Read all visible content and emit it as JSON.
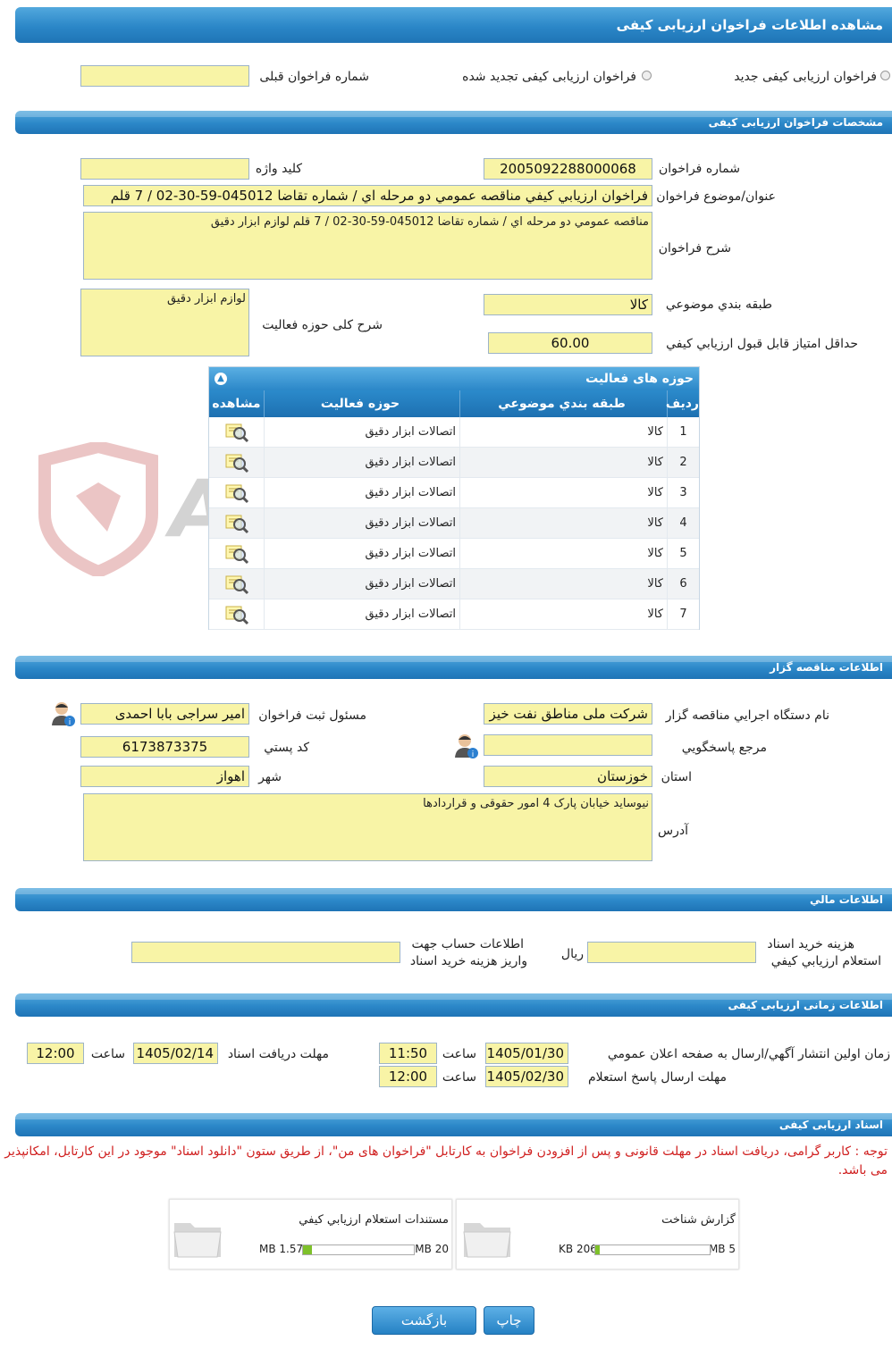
{
  "header": {
    "title": "مشاهده اطلاعات فراخوان ارزیابی کیفی"
  },
  "callType": {
    "new": "فراخوان ارزیابی کیفی جدید",
    "renewed": "فراخوان ارزیابی کیفی تجدید شده",
    "prevNumberLabel": "شماره فراخوان قبلی",
    "prevNumberValue": ""
  },
  "specs": {
    "title": "مشخصات فراخوان ارزیابی کیفی",
    "numberLabel": "شماره فراخوان",
    "numberValue": "2005092288000068",
    "keywordLabel": "کلید واژه",
    "keywordValue": "",
    "subjectLabel": "عنوان/موضوع فراخوان",
    "subjectValue": "فراخوان ارزيابي کيفي مناقصه عمومي دو مرحله اي / شماره تقاضا 045012-59-30-02 / 7 قلم",
    "descLabel": "شرح فراخوان",
    "descValue": "مناقصه عمومي دو مرحله اي / شماره تقاضا 045012-59-30-02 / 7 قلم لوازم ابزار دقيق",
    "categoryLabel": "طبقه بندي موضوعي",
    "categoryValue": "کالا",
    "activityDescLabel": "شرح کلی حوزه فعالیت",
    "activityDescValue": "لوازم ابزار دقيق",
    "minScoreLabel": "حداقل امتياز قابل قبول ارزيابي کيفي",
    "minScoreValue": "60.00"
  },
  "activities": {
    "title": "حوزه های فعالیت",
    "columns": [
      "رديف",
      "طبقه بندي موضوعي",
      "حوزه فعاليت",
      "مشاهده"
    ],
    "rows": [
      {
        "n": "1",
        "cat": "کالا",
        "field": "اتصالات ابزار دقيق"
      },
      {
        "n": "2",
        "cat": "کالا",
        "field": "اتصالات ابزار دقيق"
      },
      {
        "n": "3",
        "cat": "کالا",
        "field": "اتصالات ابزار دقيق"
      },
      {
        "n": "4",
        "cat": "کالا",
        "field": "اتصالات ابزار دقيق"
      },
      {
        "n": "5",
        "cat": "کالا",
        "field": "اتصالات ابزار دقيق"
      },
      {
        "n": "6",
        "cat": "کالا",
        "field": "اتصالات ابزار دقيق"
      },
      {
        "n": "7",
        "cat": "کالا",
        "field": "اتصالات ابزار دقيق"
      }
    ]
  },
  "watermark": "AriaTender.neT",
  "tenderer": {
    "title": "اطلاعات مناقصه گزار",
    "orgLabel": "نام دستگاه اجرايي مناقصه گزار",
    "orgValue": "شرکت ملی مناطق نفت خیز جنوب",
    "responsibleLabel": "مسئول ثبت فراخوان",
    "responsibleValue": "امیر سراجی بابا احمدی",
    "refLabel": "مرجع پاسخگويي",
    "refValue": "",
    "postalLabel": "کد پستي",
    "postalValue": "6173873375",
    "provinceLabel": "استان",
    "provinceValue": "خوزستان",
    "cityLabel": "شهر",
    "cityValue": "اهواز",
    "addressLabel": "آدرس",
    "addressValue": "نیوساید خیابان پارک 4 امور حقوقی و قراردادها"
  },
  "finance": {
    "title": "اطلاعات مالي",
    "costLabel1": "هزينه خريد اسناد",
    "costLabel2": "استعلام ارزيابي کيفي",
    "costValue": "",
    "currency": "ريال",
    "accountLabel1": "اطلاعات حساب جهت",
    "accountLabel2": "واريز هزينه خريد اسناد",
    "accountValue": ""
  },
  "timing": {
    "title": "اطلاعات زمانی ارزیابی کیفی",
    "publishLabel": "زمان اولين انتشار آگهي/ارسال به صفحه اعلان عمومي",
    "publishDate": "1405/01/30",
    "publishTime": "11:50",
    "docDeadlineLabel": "مهلت دريافت اسناد",
    "docDeadlineDate": "1405/02/14",
    "docDeadlineTime": "12:00",
    "replyDeadlineLabel": "مهلت ارسال پاسخ استعلام",
    "replyDeadlineDate": "1405/02/30",
    "replyDeadlineTime": "12:00",
    "timeLabel": "ساعت"
  },
  "docs": {
    "title": "اسناد ارزیابی کیفی",
    "note": "توجه : کاربر گرامی، دریافت اسناد در مهلت قانونی و پس از افزودن فراخوان به کارتابل \"فراخوان های من\"، از طریق ستون \"دانلود اسناد\" موجود در این کارتابل، امکانپذیر می باشد.",
    "files": [
      {
        "name": "گزارش شناخت",
        "size": "206 KB",
        "max": "5 MB",
        "fill": 0.04
      },
      {
        "name": "مستندات استعلام ارزيابي کيفي",
        "size": "1.57 MB",
        "max": "20 MB",
        "fill": 0.08
      }
    ]
  },
  "buttons": {
    "print": "چاپ",
    "back": "بازگشت"
  },
  "colors": {
    "headerBlue": "#2b87c8",
    "fieldYellow": "#f8f4a6",
    "noteRed": "#d02020",
    "progressGreen": "#7ec12a"
  }
}
